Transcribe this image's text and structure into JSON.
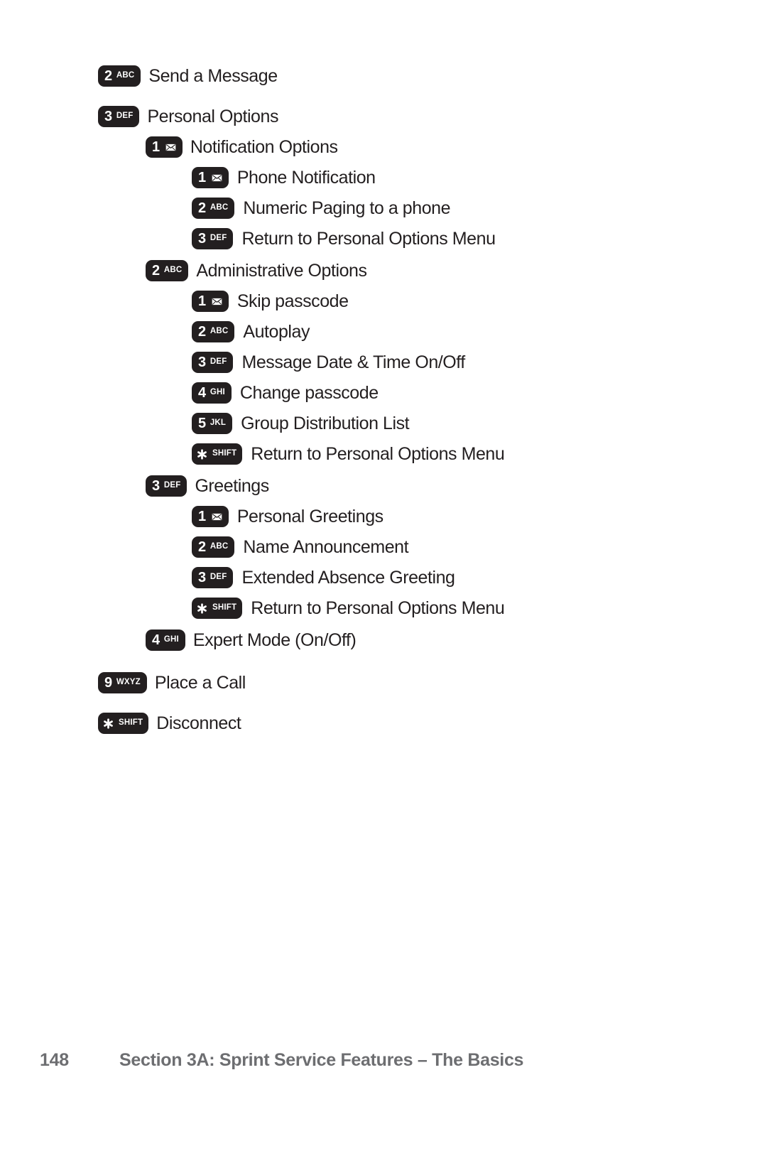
{
  "page": {
    "background": "#ffffff",
    "text_color": "#231f20",
    "badge_color": "#231f20",
    "footer_color": "#6d6e71"
  },
  "menu": {
    "items": [
      {
        "level": 0,
        "key": {
          "digit": "2",
          "letters": "ABC",
          "glyph": "none",
          "icon_name": "keypad-key-2-abc"
        },
        "label": "Send a Message"
      },
      {
        "level": 0,
        "key": {
          "digit": "3",
          "letters": "DEF",
          "glyph": "none",
          "icon_name": "keypad-key-3-def"
        },
        "label": "Personal Options"
      },
      {
        "level": 1,
        "key": {
          "digit": "1",
          "letters": "",
          "glyph": "envelope",
          "icon_name": "keypad-key-1-envelope"
        },
        "label": "Notification Options"
      },
      {
        "level": 2,
        "key": {
          "digit": "1",
          "letters": "",
          "glyph": "envelope",
          "icon_name": "keypad-key-1-envelope"
        },
        "label": "Phone Notification"
      },
      {
        "level": 2,
        "key": {
          "digit": "2",
          "letters": "ABC",
          "glyph": "none",
          "icon_name": "keypad-key-2-abc"
        },
        "label": "Numeric Paging to a phone"
      },
      {
        "level": 2,
        "key": {
          "digit": "3",
          "letters": "DEF",
          "glyph": "none",
          "icon_name": "keypad-key-3-def"
        },
        "label": "Return to Personal Options Menu"
      },
      {
        "level": 1,
        "key": {
          "digit": "2",
          "letters": "ABC",
          "glyph": "none",
          "icon_name": "keypad-key-2-abc"
        },
        "label": "Administrative Options"
      },
      {
        "level": 2,
        "key": {
          "digit": "1",
          "letters": "",
          "glyph": "envelope",
          "icon_name": "keypad-key-1-envelope"
        },
        "label": "Skip passcode"
      },
      {
        "level": 2,
        "key": {
          "digit": "2",
          "letters": "ABC",
          "glyph": "none",
          "icon_name": "keypad-key-2-abc"
        },
        "label": "Autoplay"
      },
      {
        "level": 2,
        "key": {
          "digit": "3",
          "letters": "DEF",
          "glyph": "none",
          "icon_name": "keypad-key-3-def"
        },
        "label": "Message Date & Time On/Off"
      },
      {
        "level": 2,
        "key": {
          "digit": "4",
          "letters": "GHI",
          "glyph": "none",
          "icon_name": "keypad-key-4-ghi"
        },
        "label": "Change passcode"
      },
      {
        "level": 2,
        "key": {
          "digit": "5",
          "letters": "JKL",
          "glyph": "none",
          "icon_name": "keypad-key-5-jkl"
        },
        "label": "Group Distribution List"
      },
      {
        "level": 2,
        "key": {
          "digit": "",
          "letters": "SHIFT",
          "glyph": "star",
          "icon_name": "keypad-key-star-shift"
        },
        "label": "Return to Personal Options Menu"
      },
      {
        "level": 1,
        "key": {
          "digit": "3",
          "letters": "DEF",
          "glyph": "none",
          "icon_name": "keypad-key-3-def"
        },
        "label": "Greetings"
      },
      {
        "level": 2,
        "key": {
          "digit": "1",
          "letters": "",
          "glyph": "envelope",
          "icon_name": "keypad-key-1-envelope"
        },
        "label": "Personal Greetings"
      },
      {
        "level": 2,
        "key": {
          "digit": "2",
          "letters": "ABC",
          "glyph": "none",
          "icon_name": "keypad-key-2-abc"
        },
        "label": "Name Announcement"
      },
      {
        "level": 2,
        "key": {
          "digit": "3",
          "letters": "DEF",
          "glyph": "none",
          "icon_name": "keypad-key-3-def"
        },
        "label": "Extended Absence Greeting"
      },
      {
        "level": 2,
        "key": {
          "digit": "",
          "letters": "SHIFT",
          "glyph": "star",
          "icon_name": "keypad-key-star-shift"
        },
        "label": "Return to Personal Options Menu"
      },
      {
        "level": 1,
        "key": {
          "digit": "4",
          "letters": "GHI",
          "glyph": "none",
          "icon_name": "keypad-key-4-ghi"
        },
        "label": "Expert Mode (On/Off)"
      },
      {
        "level": 0,
        "key": {
          "digit": "9",
          "letters": "WXYZ",
          "glyph": "none",
          "icon_name": "keypad-key-9-wxyz"
        },
        "label": "Place a Call"
      },
      {
        "level": 0,
        "key": {
          "digit": "",
          "letters": "SHIFT",
          "glyph": "star",
          "icon_name": "keypad-key-star-shift"
        },
        "label": "Disconnect"
      }
    ]
  },
  "footer": {
    "page_number": "148",
    "title": "Section 3A: Sprint Service Features – The Basics"
  }
}
